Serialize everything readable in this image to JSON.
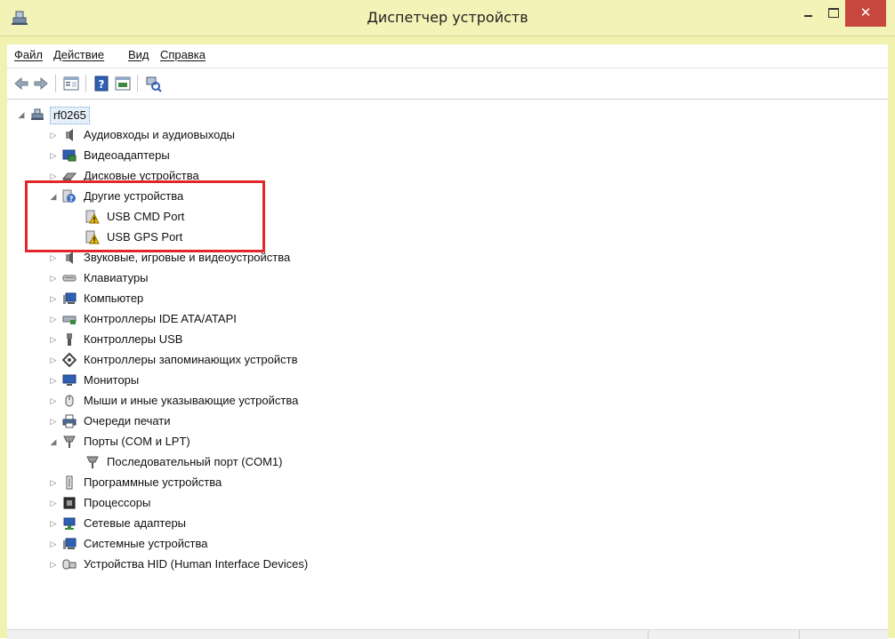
{
  "window": {
    "title": "Диспетчер устройств"
  },
  "menu": [
    {
      "label": "Файл"
    },
    {
      "label": "Действие"
    },
    {
      "label": "Вид"
    },
    {
      "label": "Справка"
    }
  ],
  "toolbar": [
    "back-icon",
    "forward-icon",
    "properties-icon",
    "help-icon",
    "update-driver-icon",
    "scan-hardware-icon"
  ],
  "tree": {
    "root": "rf0265",
    "items": [
      {
        "label": "Аудиовходы и аудиовыходы",
        "expanded": false
      },
      {
        "label": "Видеоадаптеры",
        "expanded": false
      },
      {
        "label": "Дисковые устройства",
        "expanded": false
      },
      {
        "label": "Другие устройства",
        "expanded": true
      },
      {
        "label": "USB CMD Port",
        "child": true
      },
      {
        "label": "USB GPS Port",
        "child": true
      },
      {
        "label": "Звуковые, игровые и видеоустройства",
        "expanded": false
      },
      {
        "label": "Клавиатуры",
        "expanded": false
      },
      {
        "label": "Компьютер",
        "expanded": false
      },
      {
        "label": "Контроллеры IDE ATA/ATAPI",
        "expanded": false
      },
      {
        "label": "Контроллеры USB",
        "expanded": false
      },
      {
        "label": "Контроллеры запоминающих устройств",
        "expanded": false
      },
      {
        "label": "Мониторы",
        "expanded": false
      },
      {
        "label": "Мыши и иные указывающие устройства",
        "expanded": false
      },
      {
        "label": "Очереди печати",
        "expanded": false
      },
      {
        "label": "Порты (COM и LPT)",
        "expanded": true
      },
      {
        "label": "Последовательный порт (COM1)",
        "child": true
      },
      {
        "label": "Программные устройства",
        "expanded": false
      },
      {
        "label": "Процессоры",
        "expanded": false
      },
      {
        "label": "Сетевые адаптеры",
        "expanded": false
      },
      {
        "label": "Системные устройства",
        "expanded": false
      },
      {
        "label": "Устройства HID (Human Interface Devices)",
        "expanded": false
      }
    ]
  },
  "colors": {
    "frame": "#f3f3b7",
    "close": "#c7463d",
    "highlight": "#e3262c"
  }
}
